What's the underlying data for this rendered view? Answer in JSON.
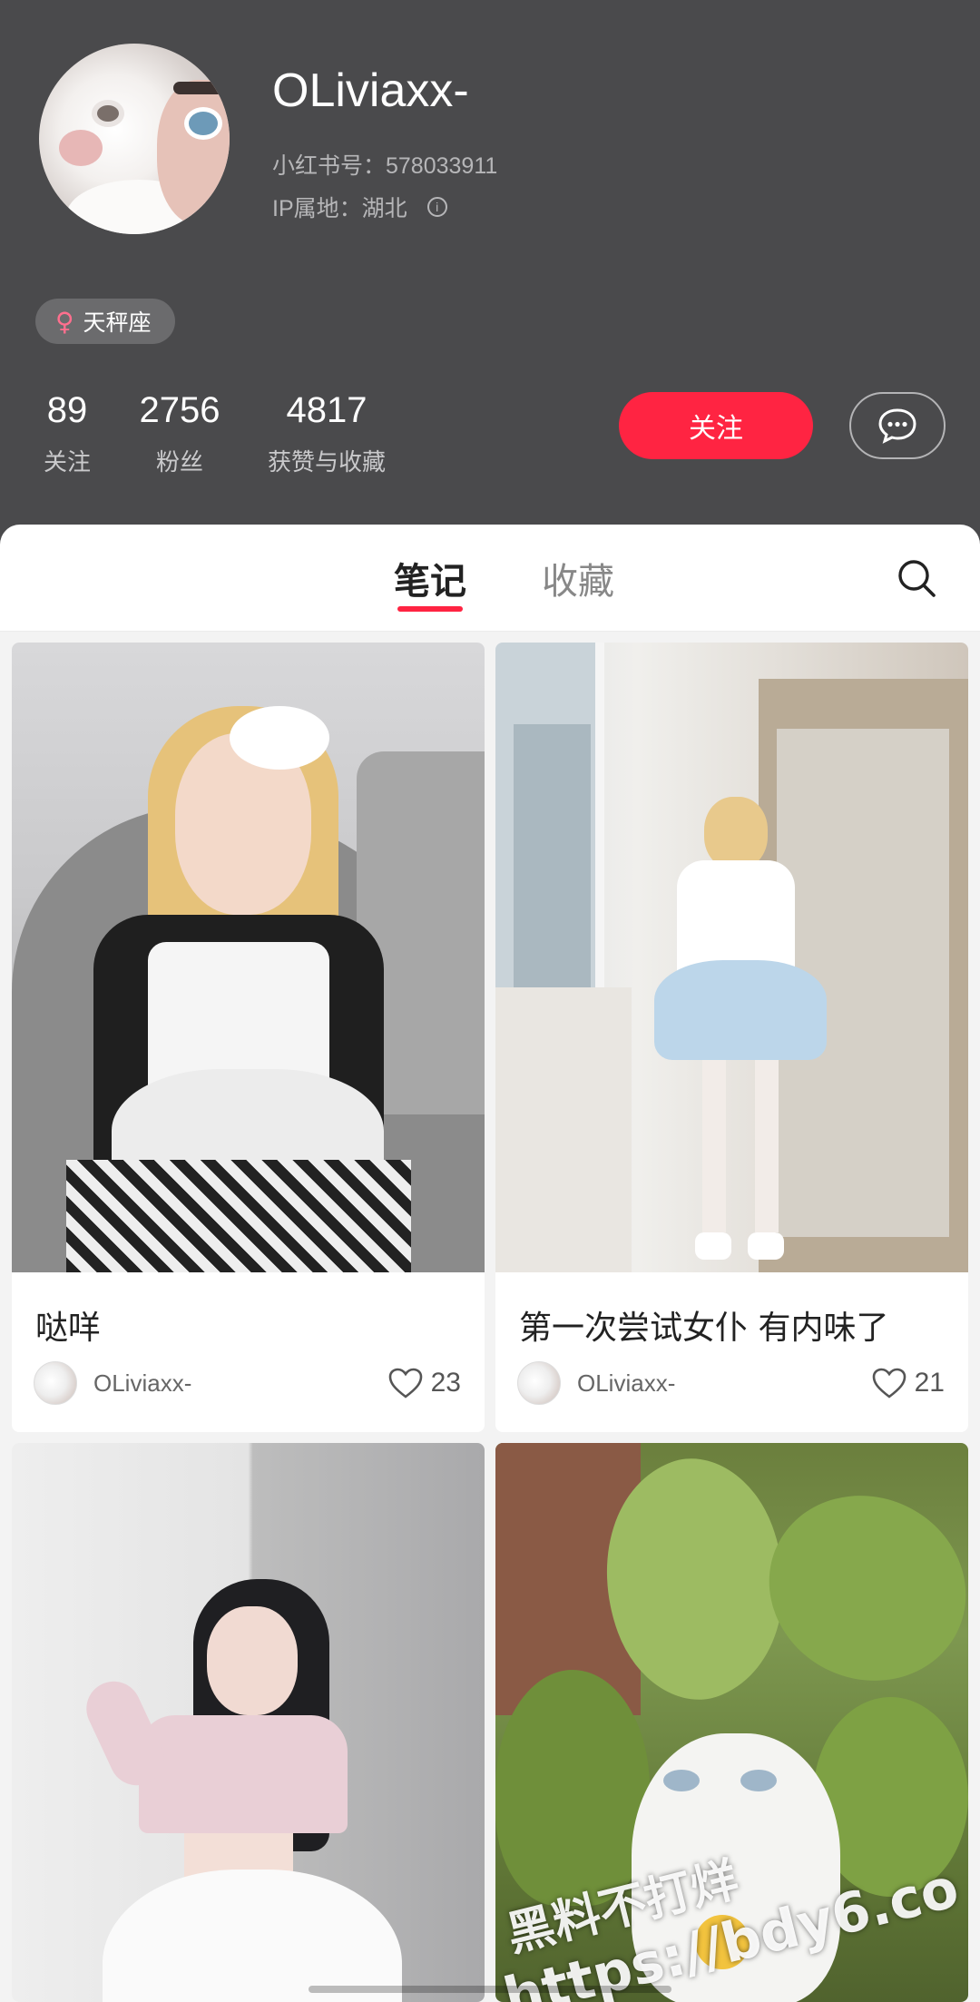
{
  "profile": {
    "username": "OLiviaxx-",
    "xhs_id": "小红书号：578033911",
    "ip_location": "IP属地：湖北",
    "info_icon": "info-icon",
    "badge": {
      "icon": "female-icon",
      "label": "天秤座"
    }
  },
  "stats": [
    {
      "value": "89",
      "label": "关注"
    },
    {
      "value": "2756",
      "label": "粉丝"
    },
    {
      "value": "4817",
      "label": "获赞与收藏"
    }
  ],
  "actions": {
    "follow_label": "关注",
    "message_icon": "chat-bubble-icon"
  },
  "colors": {
    "header_bg": "#4a4a4c",
    "accent": "#ff2442"
  },
  "tabs": {
    "notes": "笔记",
    "favorites": "收藏",
    "active": "笔记",
    "search_icon": "search-icon"
  },
  "notes": [
    {
      "title": "哒咩",
      "author": "OLiviaxx-",
      "likes": "23"
    },
    {
      "title": "第一次尝试女仆 有内味了",
      "author": "OLiviaxx-",
      "likes": "21"
    }
  ],
  "watermark": {
    "line1": "黑料不打烊",
    "line2": "https://bdy6.co"
  }
}
